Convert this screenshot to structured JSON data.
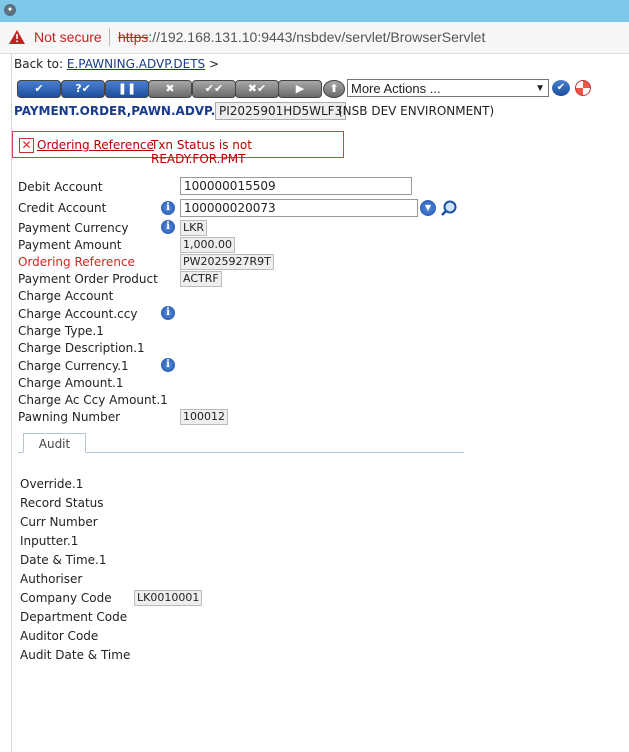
{
  "browser": {
    "security_label": "Not secure",
    "url_scheme": "https",
    "url_rest": "://192.168.131.10:9443/nsbdev/servlet/BrowserServlet"
  },
  "nav": {
    "back_label": "Back to:",
    "back_link": "E.PAWNING.ADVP.DETS",
    "back_suffix": ">"
  },
  "toolbar": {
    "buttons": [
      {
        "name": "commit",
        "glyph": "✔"
      },
      {
        "name": "validate",
        "glyph": "?✔"
      },
      {
        "name": "hold",
        "glyph": "❚❚"
      },
      {
        "name": "delete",
        "glyph": "✖"
      },
      {
        "name": "authorise",
        "glyph": "✔✔"
      },
      {
        "name": "reverse",
        "glyph": "✖✔"
      },
      {
        "name": "next",
        "glyph": "▶"
      },
      {
        "name": "upload",
        "glyph": "⬆"
      }
    ],
    "more_actions": "More Actions ..."
  },
  "app": {
    "title": "PAYMENT.ORDER,PAWN.ADVP.NSB",
    "txn_id": "PI2025901HD5WLF3",
    "environment": "(NSB DEV ENVIRONMENT)"
  },
  "error": {
    "field": "Ordering Reference",
    "message": "Txn Status is not READY.FOR.PMT"
  },
  "form": {
    "debit_account": {
      "label": "Debit Account",
      "value": "100000015509"
    },
    "credit_account": {
      "label": "Credit Account",
      "value": "100000020073"
    },
    "payment_currency": {
      "label": "Payment Currency",
      "value": "LKR"
    },
    "payment_amount": {
      "label": "Payment Amount",
      "value": "1,000.00"
    },
    "ordering_reference": {
      "label": "Ordering Reference",
      "value": "PW2025927R9T"
    },
    "payment_order_product": {
      "label": "Payment Order Product",
      "value": "ACTRF"
    },
    "charge_account": {
      "label": "Charge Account"
    },
    "charge_account_ccy": {
      "label": "Charge Account.ccy"
    },
    "charge_type": {
      "label": "Charge Type.1"
    },
    "charge_description": {
      "label": "Charge Description.1"
    },
    "charge_currency": {
      "label": "Charge Currency.1"
    },
    "charge_amount": {
      "label": "Charge Amount.1"
    },
    "charge_ac_ccy_amount": {
      "label": "Charge Ac Ccy Amount.1"
    },
    "pawning_number": {
      "label": "Pawning Number",
      "value": "100012"
    }
  },
  "audit": {
    "tab_label": "Audit",
    "override": "Override.1",
    "record_status": "Record Status",
    "curr_number": "Curr Number",
    "inputter": "Inputter.1",
    "date_time": "Date & Time.1",
    "authoriser": "Authoriser",
    "company_code": {
      "label": "Company Code",
      "value": "LK0010001"
    },
    "department_code": "Department Code",
    "auditor_code": "Auditor Code",
    "audit_date_time": "Audit Date & Time"
  }
}
